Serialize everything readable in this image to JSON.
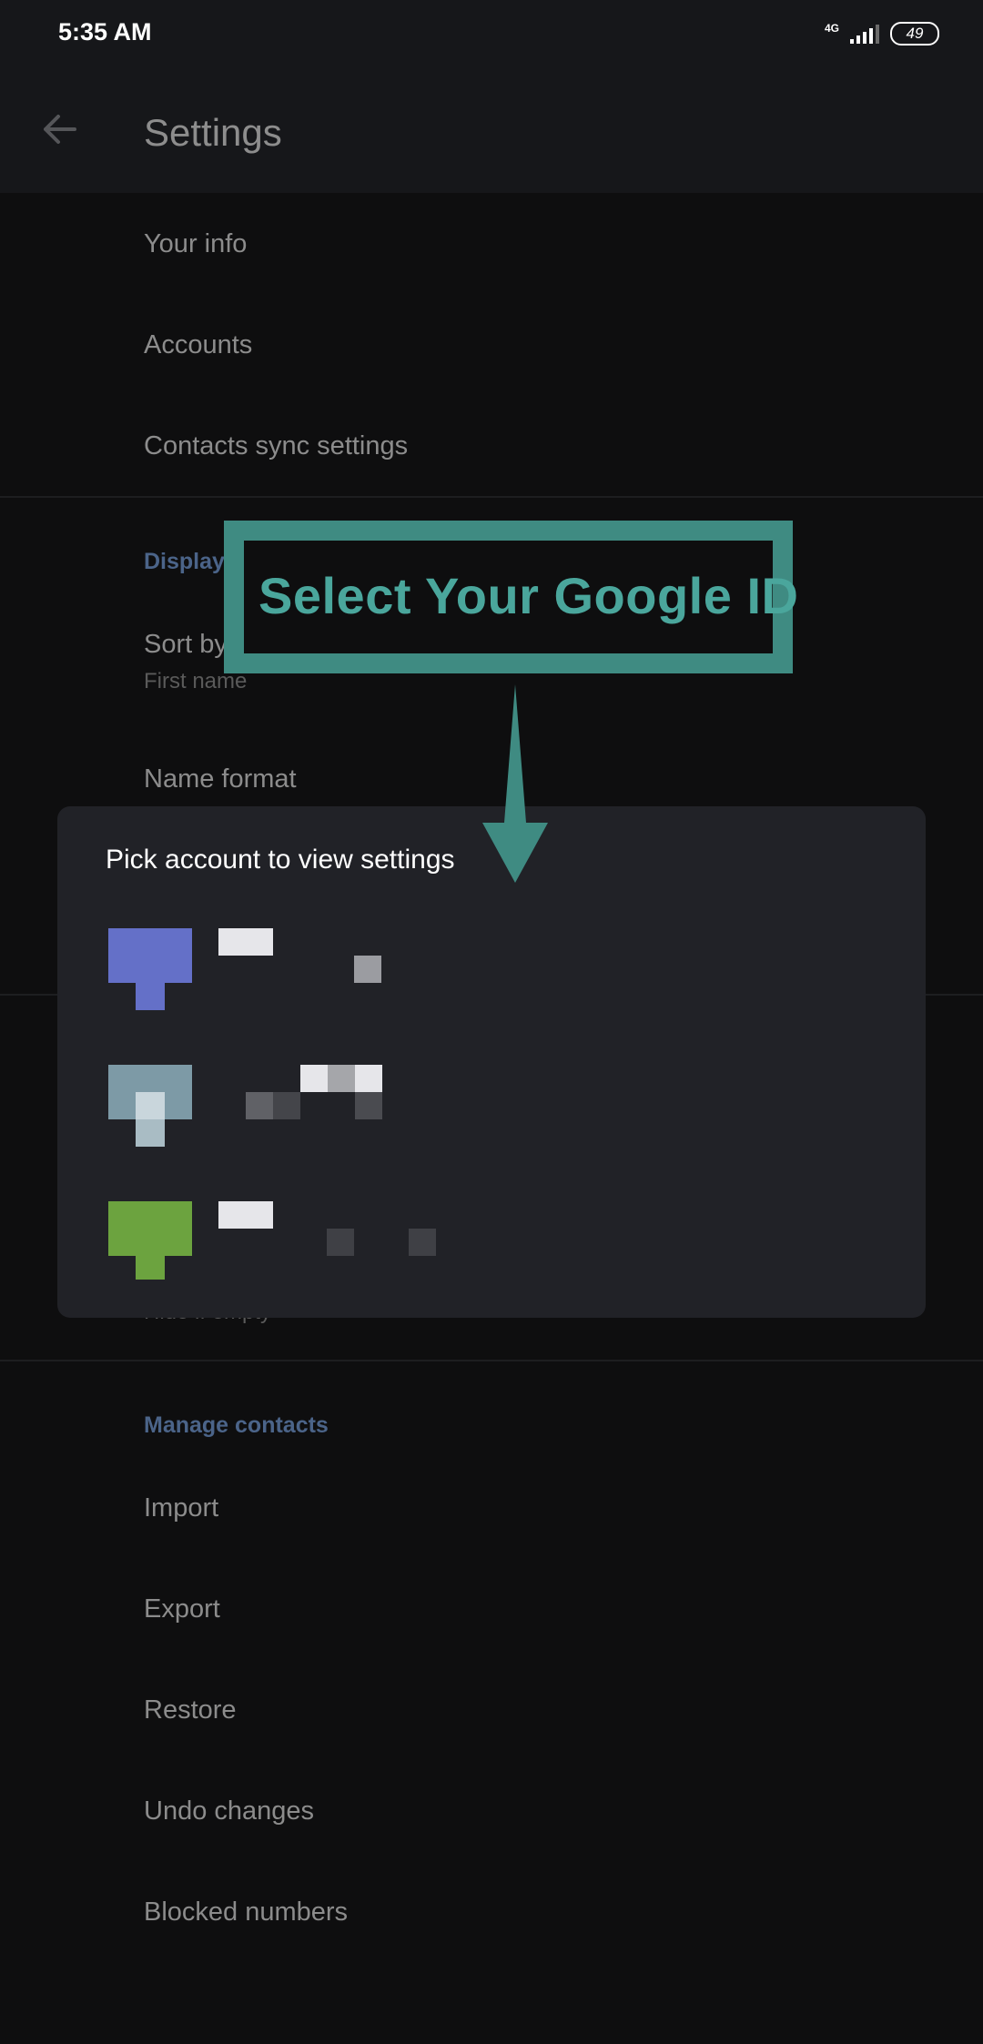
{
  "status_bar": {
    "time": "5:35 AM",
    "network": "4G",
    "battery": "49"
  },
  "app_bar": {
    "title": "Settings",
    "back_icon": "arrow-back-icon"
  },
  "settings": {
    "your_info": "Your info",
    "accounts": "Accounts",
    "contacts_sync": "Contacts sync settings",
    "display_section": "Display",
    "sort_by": {
      "label": "Sort by",
      "value": "First name"
    },
    "name_format": "Name format",
    "hidden_row_value": "Hide if empty"
  },
  "manage_contacts": {
    "section": "Manage contacts",
    "items": [
      "Import",
      "Export",
      "Restore",
      "Undo changes",
      "Blocked numbers"
    ]
  },
  "dialog": {
    "title": "Pick account to view settings",
    "accounts": [
      {
        "avatar_color": "#6470c8"
      },
      {
        "avatar_color": "#7d9aa6"
      },
      {
        "avatar_color": "#6ca33f"
      }
    ]
  },
  "annotation": {
    "text": "Select Your Google ID",
    "color": "#3f8b82"
  },
  "colors": {
    "background": "#0e0e0f",
    "app_bar": "#16171a",
    "dialog": "#212227",
    "section_header": "#4b6489"
  }
}
